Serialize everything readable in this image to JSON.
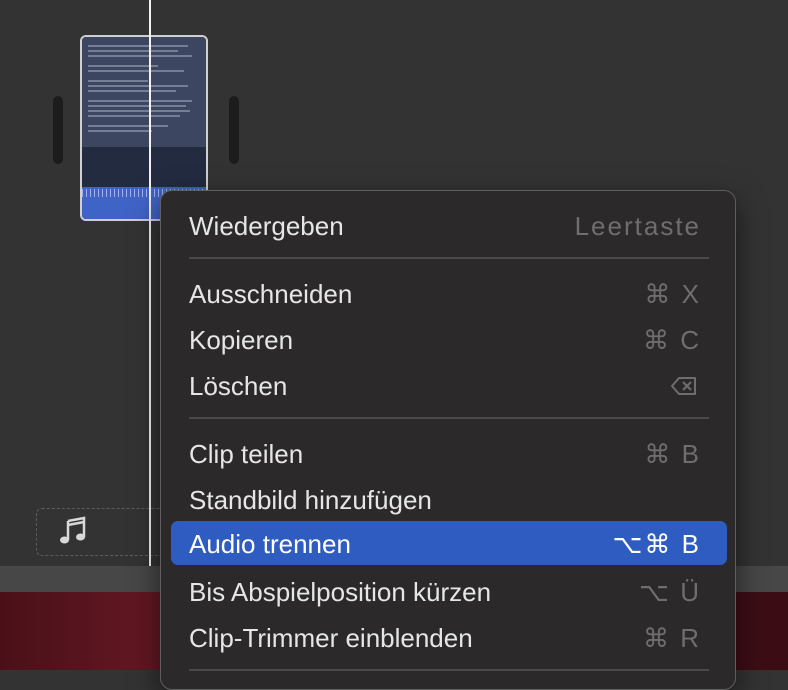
{
  "menu": {
    "items": [
      {
        "label": "Wiedergeben",
        "shortcut": "Leertaste"
      },
      {
        "label": "Ausschneiden",
        "shortcut": "⌘ X"
      },
      {
        "label": "Kopieren",
        "shortcut": "⌘ C"
      },
      {
        "label": "Löschen",
        "shortcut_icon": "delete-key-icon"
      },
      {
        "label": "Clip teilen",
        "shortcut": "⌘ B"
      },
      {
        "label": "Standbild hinzufügen",
        "shortcut": ""
      },
      {
        "label": "Audio trennen",
        "shortcut": "⌥⌘ B",
        "selected": true
      },
      {
        "label": "Bis Abspielposition kürzen",
        "shortcut": "⌥ Ü"
      },
      {
        "label": "Clip-Trimmer einblenden",
        "shortcut": "⌘ R"
      }
    ]
  },
  "timeline": {
    "audio_lane_icon": "music-note-icon"
  },
  "colors": {
    "menu_background": "#2b2929",
    "selection": "#2f5cc0",
    "timeline_background": "#333333",
    "playhead": "#f2f2f2"
  }
}
